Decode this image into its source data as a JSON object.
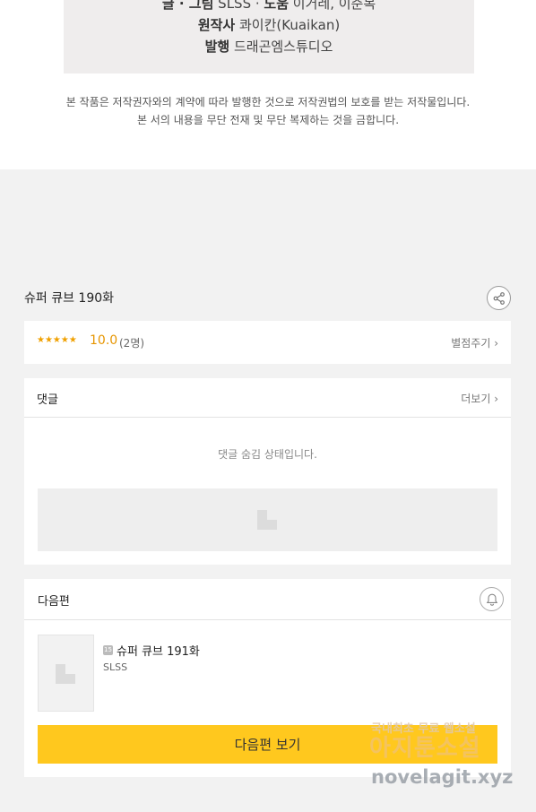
{
  "credits": {
    "line1_label1": "글 · 그림",
    "line1_value1": "SLSS",
    "line1_sep": " · ",
    "line1_label2": "노움",
    "line1_value2": "이거레, 이준복",
    "line2_label": "원작사",
    "line2_value": "콰이칸(Kuaikan)",
    "line3_label": "발행",
    "line3_value": "드래곤엠스튜디오"
  },
  "copyright": {
    "line1": "본 작품은 저작권자와의 계약에 따라 발행한 것으로 저작권법의 보호를 받는 저작물입니다.",
    "line2": "본 서의 내용을 무단 전재 및 무단 복제하는 것을 금합니다."
  },
  "episode": {
    "title": "슈퍼 큐브 190화"
  },
  "rating": {
    "stars": "★★★★★",
    "score": "10.0",
    "count": "(2명)",
    "rate_link": "별점주기 ›"
  },
  "comments": {
    "label": "댓글",
    "more": "더보기 ›",
    "hidden_message": "댓글 숨김 상태입니다."
  },
  "next_episode": {
    "label": "다음편",
    "age_badge": "15",
    "title": "슈퍼 큐브 191화",
    "author": "SLSS",
    "button_label": "다음편 보기"
  },
  "watermark": {
    "line1": "국내최초 무료 웹소설",
    "line2": "아지툰소설",
    "line3": "novelagit.xyz"
  },
  "colors": {
    "accent_button": "#ffc81e",
    "star": "#f0a000",
    "background": "#f2f2f2"
  },
  "icons": {
    "share": "share-icon",
    "bell": "bell-icon",
    "placeholder": "image-placeholder-icon"
  }
}
